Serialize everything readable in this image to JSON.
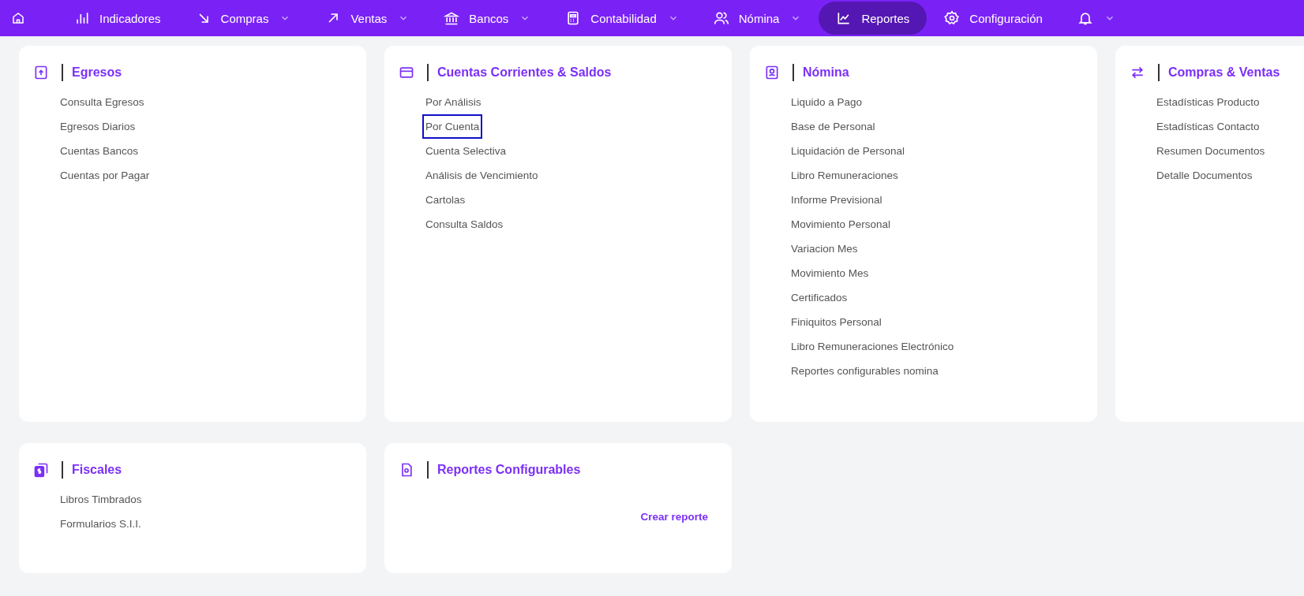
{
  "nav": {
    "items": [
      {
        "label": "Indicadores",
        "dropdown": false,
        "selected": false
      },
      {
        "label": "Compras",
        "dropdown": true,
        "selected": false
      },
      {
        "label": "Ventas",
        "dropdown": true,
        "selected": false
      },
      {
        "label": "Bancos",
        "dropdown": true,
        "selected": false
      },
      {
        "label": "Contabilidad",
        "dropdown": true,
        "selected": false
      },
      {
        "label": "Nómina",
        "dropdown": true,
        "selected": false
      },
      {
        "label": "Reportes",
        "dropdown": false,
        "selected": true
      },
      {
        "label": "Configuración",
        "dropdown": false,
        "selected": false
      }
    ],
    "notifications": {
      "dropdown": true
    }
  },
  "cards": [
    {
      "title": "Egresos",
      "items": [
        {
          "label": "Consulta Egresos",
          "focused": false
        },
        {
          "label": "Egresos Diarios",
          "focused": false
        },
        {
          "label": "Cuentas Bancos",
          "focused": false
        },
        {
          "label": "Cuentas por Pagar",
          "focused": false
        }
      ]
    },
    {
      "title": "Cuentas Corrientes & Saldos",
      "items": [
        {
          "label": "Por Análisis",
          "focused": false
        },
        {
          "label": "Por Cuenta",
          "focused": true
        },
        {
          "label": "Cuenta Selectiva",
          "focused": false
        },
        {
          "label": "Análisis de Vencimiento",
          "focused": false
        },
        {
          "label": "Cartolas",
          "focused": false
        },
        {
          "label": "Consulta Saldos",
          "focused": false
        }
      ]
    },
    {
      "title": "Nómina",
      "items": [
        {
          "label": "Liquido a Pago",
          "focused": false
        },
        {
          "label": "Base de Personal",
          "focused": false
        },
        {
          "label": "Liquidación de Personal",
          "focused": false
        },
        {
          "label": "Libro Remuneraciones",
          "focused": false
        },
        {
          "label": "Informe Previsional",
          "focused": false
        },
        {
          "label": "Movimiento Personal",
          "focused": false
        },
        {
          "label": "Variacion Mes",
          "focused": false
        },
        {
          "label": "Movimiento Mes",
          "focused": false
        },
        {
          "label": "Certificados",
          "focused": false
        },
        {
          "label": "Finiquitos Personal",
          "focused": false
        },
        {
          "label": "Libro Remuneraciones Electrónico",
          "focused": false
        },
        {
          "label": "Reportes configurables nomina",
          "focused": false
        }
      ]
    },
    {
      "title": "Compras & Ventas",
      "items": [
        {
          "label": "Estadísticas Producto",
          "focused": false
        },
        {
          "label": "Estadísticas Contacto",
          "focused": false
        },
        {
          "label": "Resumen Documentos",
          "focused": false
        },
        {
          "label": "Detalle Documentos",
          "focused": false
        }
      ]
    },
    {
      "title": "Fiscales",
      "items": [
        {
          "label": "Libros Timbrados",
          "focused": false
        },
        {
          "label": "Formularios S.I.I.",
          "focused": false
        }
      ]
    },
    {
      "title": "Reportes Configurables",
      "action": "Crear reporte"
    }
  ]
}
